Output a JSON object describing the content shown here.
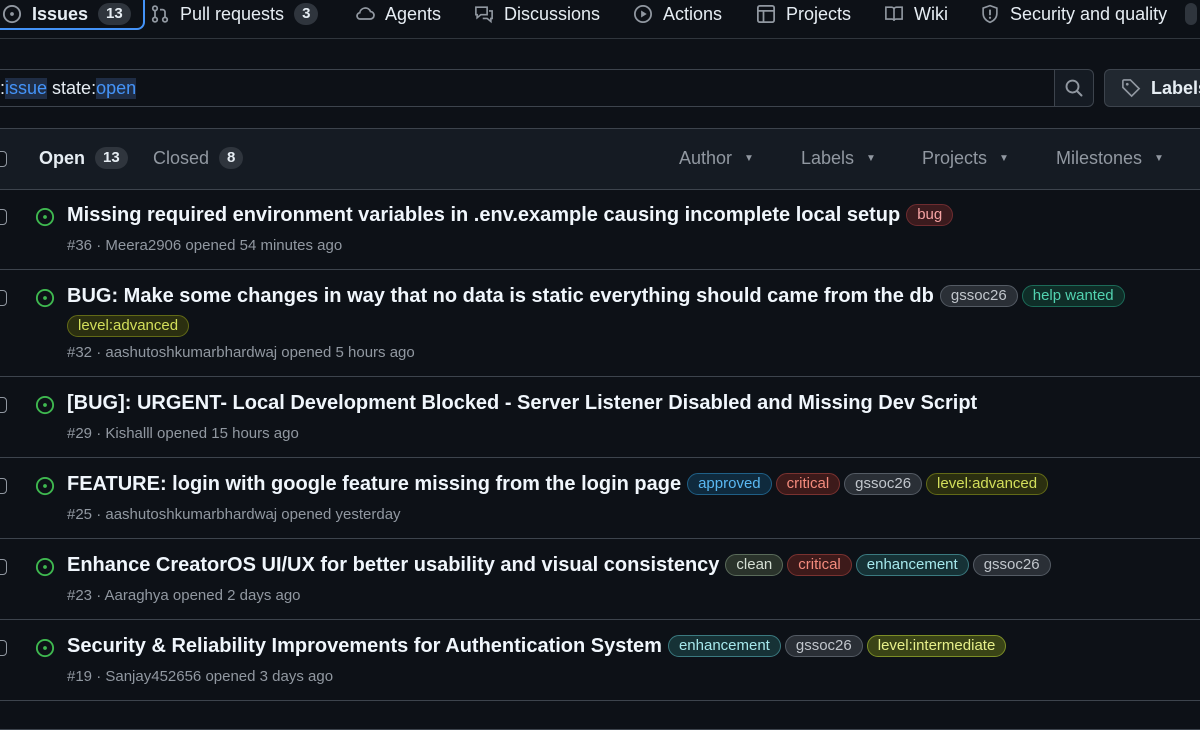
{
  "nav": {
    "tabs": [
      {
        "label": "Issues",
        "count": "13",
        "icon": "issue-opened-icon"
      },
      {
        "label": "Pull requests",
        "count": "3",
        "icon": "git-pull-request-icon"
      },
      {
        "label": "Agents",
        "icon": "agent-cloud-icon"
      },
      {
        "label": "Discussions",
        "icon": "comment-discussion-icon"
      },
      {
        "label": "Actions",
        "icon": "play-icon"
      },
      {
        "label": "Projects",
        "icon": "table-icon"
      },
      {
        "label": "Wiki",
        "icon": "book-icon"
      },
      {
        "label": "Security and quality",
        "icon": "shield-icon"
      }
    ]
  },
  "search": {
    "tokens": [
      {
        "key": "s:",
        "value": "issue"
      },
      {
        "key": " state:",
        "value": "open"
      }
    ],
    "labels_button": "Labels"
  },
  "list": {
    "open_label": "Open",
    "open_count": "13",
    "closed_label": "Closed",
    "closed_count": "8",
    "filters": [
      "Author",
      "Labels",
      "Projects",
      "Milestones"
    ]
  },
  "issues": [
    {
      "title": "Missing required environment variables in .env.example causing incomplete local setup",
      "labels": [
        {
          "text": "bug",
          "kind": "bug"
        }
      ],
      "meta": "#36 · Meera2906 opened 54 minutes ago"
    },
    {
      "title": "BUG: Make some changes in way that no data is static everything should came from the db",
      "labels": [
        {
          "text": "gssoc26",
          "kind": "gssoc"
        },
        {
          "text": "help wanted",
          "kind": "help"
        },
        {
          "text": "level:advanced",
          "kind": "level"
        }
      ],
      "meta": "#32 · aashutoshkumarbhardwaj opened 5 hours ago"
    },
    {
      "title": "[BUG]: URGENT- Local Development Blocked - Server Listener Disabled and Missing Dev Script",
      "labels": [],
      "meta": "#29 · Kishalll opened 15 hours ago"
    },
    {
      "title": "FEATURE: login with google feature missing from the login page",
      "labels": [
        {
          "text": "approved",
          "kind": "approved"
        },
        {
          "text": "critical",
          "kind": "critical"
        },
        {
          "text": "gssoc26",
          "kind": "gssoc"
        },
        {
          "text": "level:advanced",
          "kind": "level"
        }
      ],
      "meta": "#25 · aashutoshkumarbhardwaj opened yesterday"
    },
    {
      "title": "Enhance CreatorOS UI/UX for better usability and visual consistency",
      "labels": [
        {
          "text": "clean",
          "kind": "clean"
        },
        {
          "text": "critical",
          "kind": "critical"
        },
        {
          "text": "enhancement",
          "kind": "enh"
        },
        {
          "text": "gssoc26",
          "kind": "gssoc"
        }
      ],
      "meta": "#23 · Aaraghya opened 2 days ago"
    },
    {
      "title": "Security & Reliability Improvements for Authentication System",
      "labels": [
        {
          "text": "enhancement",
          "kind": "enh"
        },
        {
          "text": "gssoc26",
          "kind": "gssoc"
        },
        {
          "text": "level:intermediate",
          "kind": "inter"
        }
      ],
      "meta": "#19 · Sanjay452656 opened 3 days ago"
    }
  ]
}
